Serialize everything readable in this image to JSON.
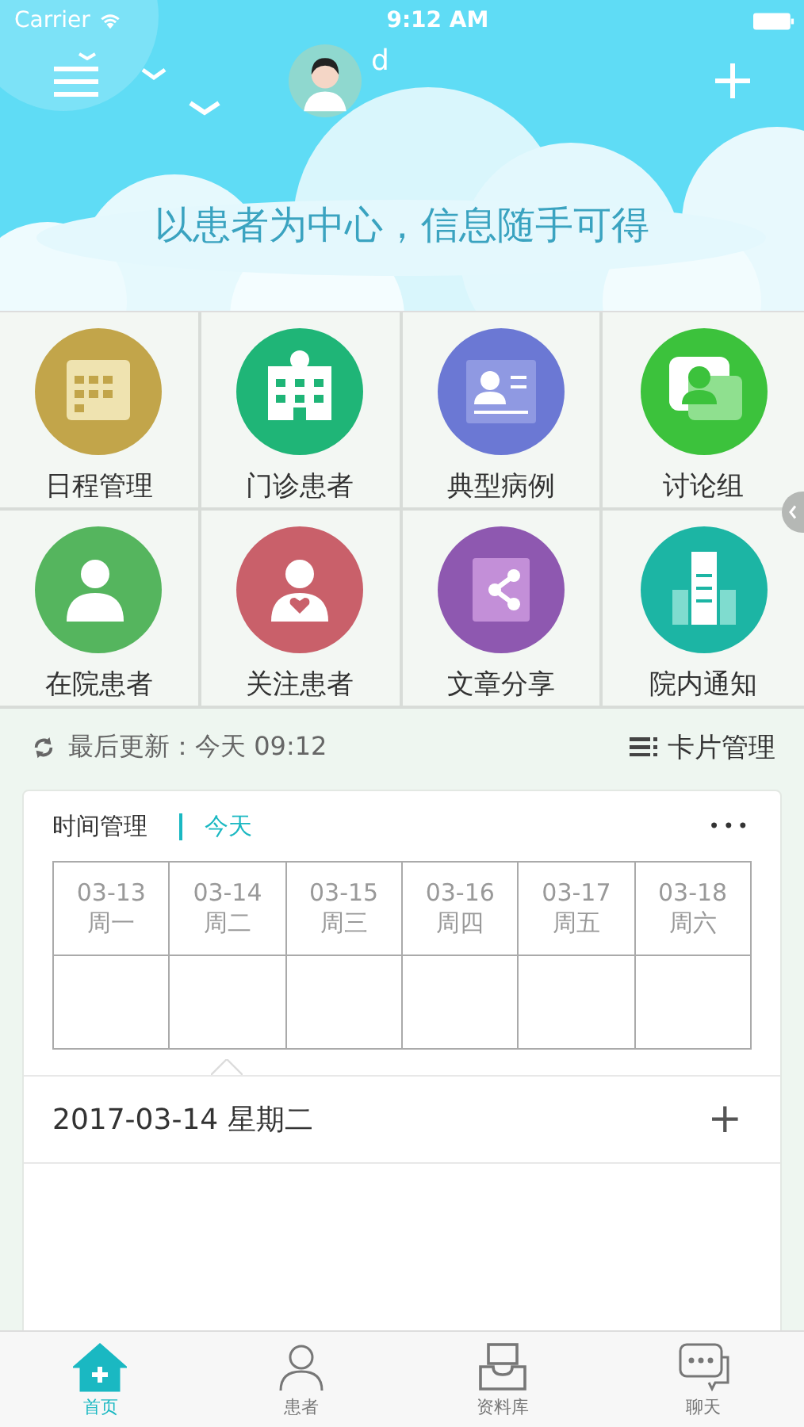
{
  "status_bar": {
    "carrier": "Carrier",
    "time": "9:12 AM"
  },
  "header": {
    "user": "d",
    "slogan": "以患者为中心，信息随手可得"
  },
  "shortcuts": [
    {
      "label": "日程管理",
      "kind": "calendar",
      "color": "#c2a54a"
    },
    {
      "label": "门诊患者",
      "kind": "hospital",
      "color": "#1fb577"
    },
    {
      "label": "典型病例",
      "kind": "record",
      "color": "#6b78d4"
    },
    {
      "label": "讨论组",
      "kind": "chat",
      "color": "#3cc23c"
    },
    {
      "label": "在院患者",
      "kind": "patient",
      "color": "#55b55e"
    },
    {
      "label": "关注患者",
      "kind": "heart",
      "color": "#c9606a"
    },
    {
      "label": "文章分享",
      "kind": "share",
      "color": "#8e58b0"
    },
    {
      "label": "院内通知",
      "kind": "building",
      "color": "#1cb5a4"
    }
  ],
  "update": {
    "text": "最后更新：今天 09:12",
    "card_manage": "卡片管理"
  },
  "schedule": {
    "title": "时间管理",
    "today": "今天",
    "more": "•••",
    "days": [
      {
        "date": "03-13",
        "weekday": "周一",
        "selected": false
      },
      {
        "date": "03-14",
        "weekday": "周二",
        "selected": true
      },
      {
        "date": "03-15",
        "weekday": "周三",
        "selected": false
      },
      {
        "date": "03-16",
        "weekday": "周四",
        "selected": false
      },
      {
        "date": "03-17",
        "weekday": "周五",
        "selected": false
      },
      {
        "date": "03-18",
        "weekday": "周六",
        "selected": false
      }
    ],
    "selected_date": "2017-03-14 星期二",
    "add": "+"
  },
  "tabs": [
    {
      "label": "首页",
      "kind": "home",
      "selected": true
    },
    {
      "label": "患者",
      "kind": "person",
      "selected": false
    },
    {
      "label": "资料库",
      "kind": "inbox",
      "selected": false
    },
    {
      "label": "聊天",
      "kind": "chat",
      "selected": false
    }
  ]
}
